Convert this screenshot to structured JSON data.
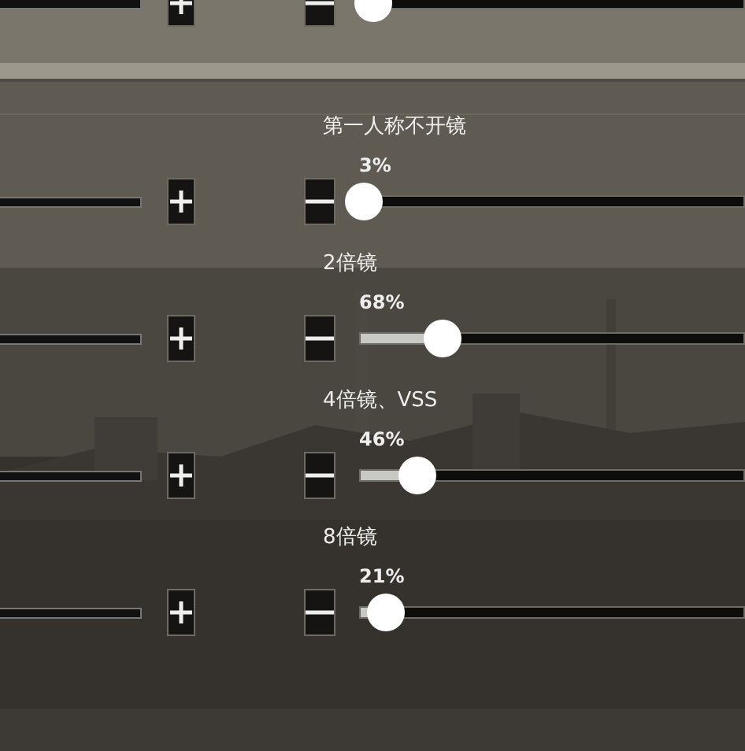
{
  "top_row": {
    "level": 0.033
  },
  "settings": [
    {
      "label": "第一人称不开镜",
      "value": "3%",
      "level": 0.008
    },
    {
      "label": "2倍镜",
      "value": "68%",
      "level": 0.216
    },
    {
      "label": "4倍镜、VSS",
      "value": "46%",
      "level": 0.147
    },
    {
      "label": "8倍镜",
      "value": "21%",
      "level": 0.065
    }
  ]
}
